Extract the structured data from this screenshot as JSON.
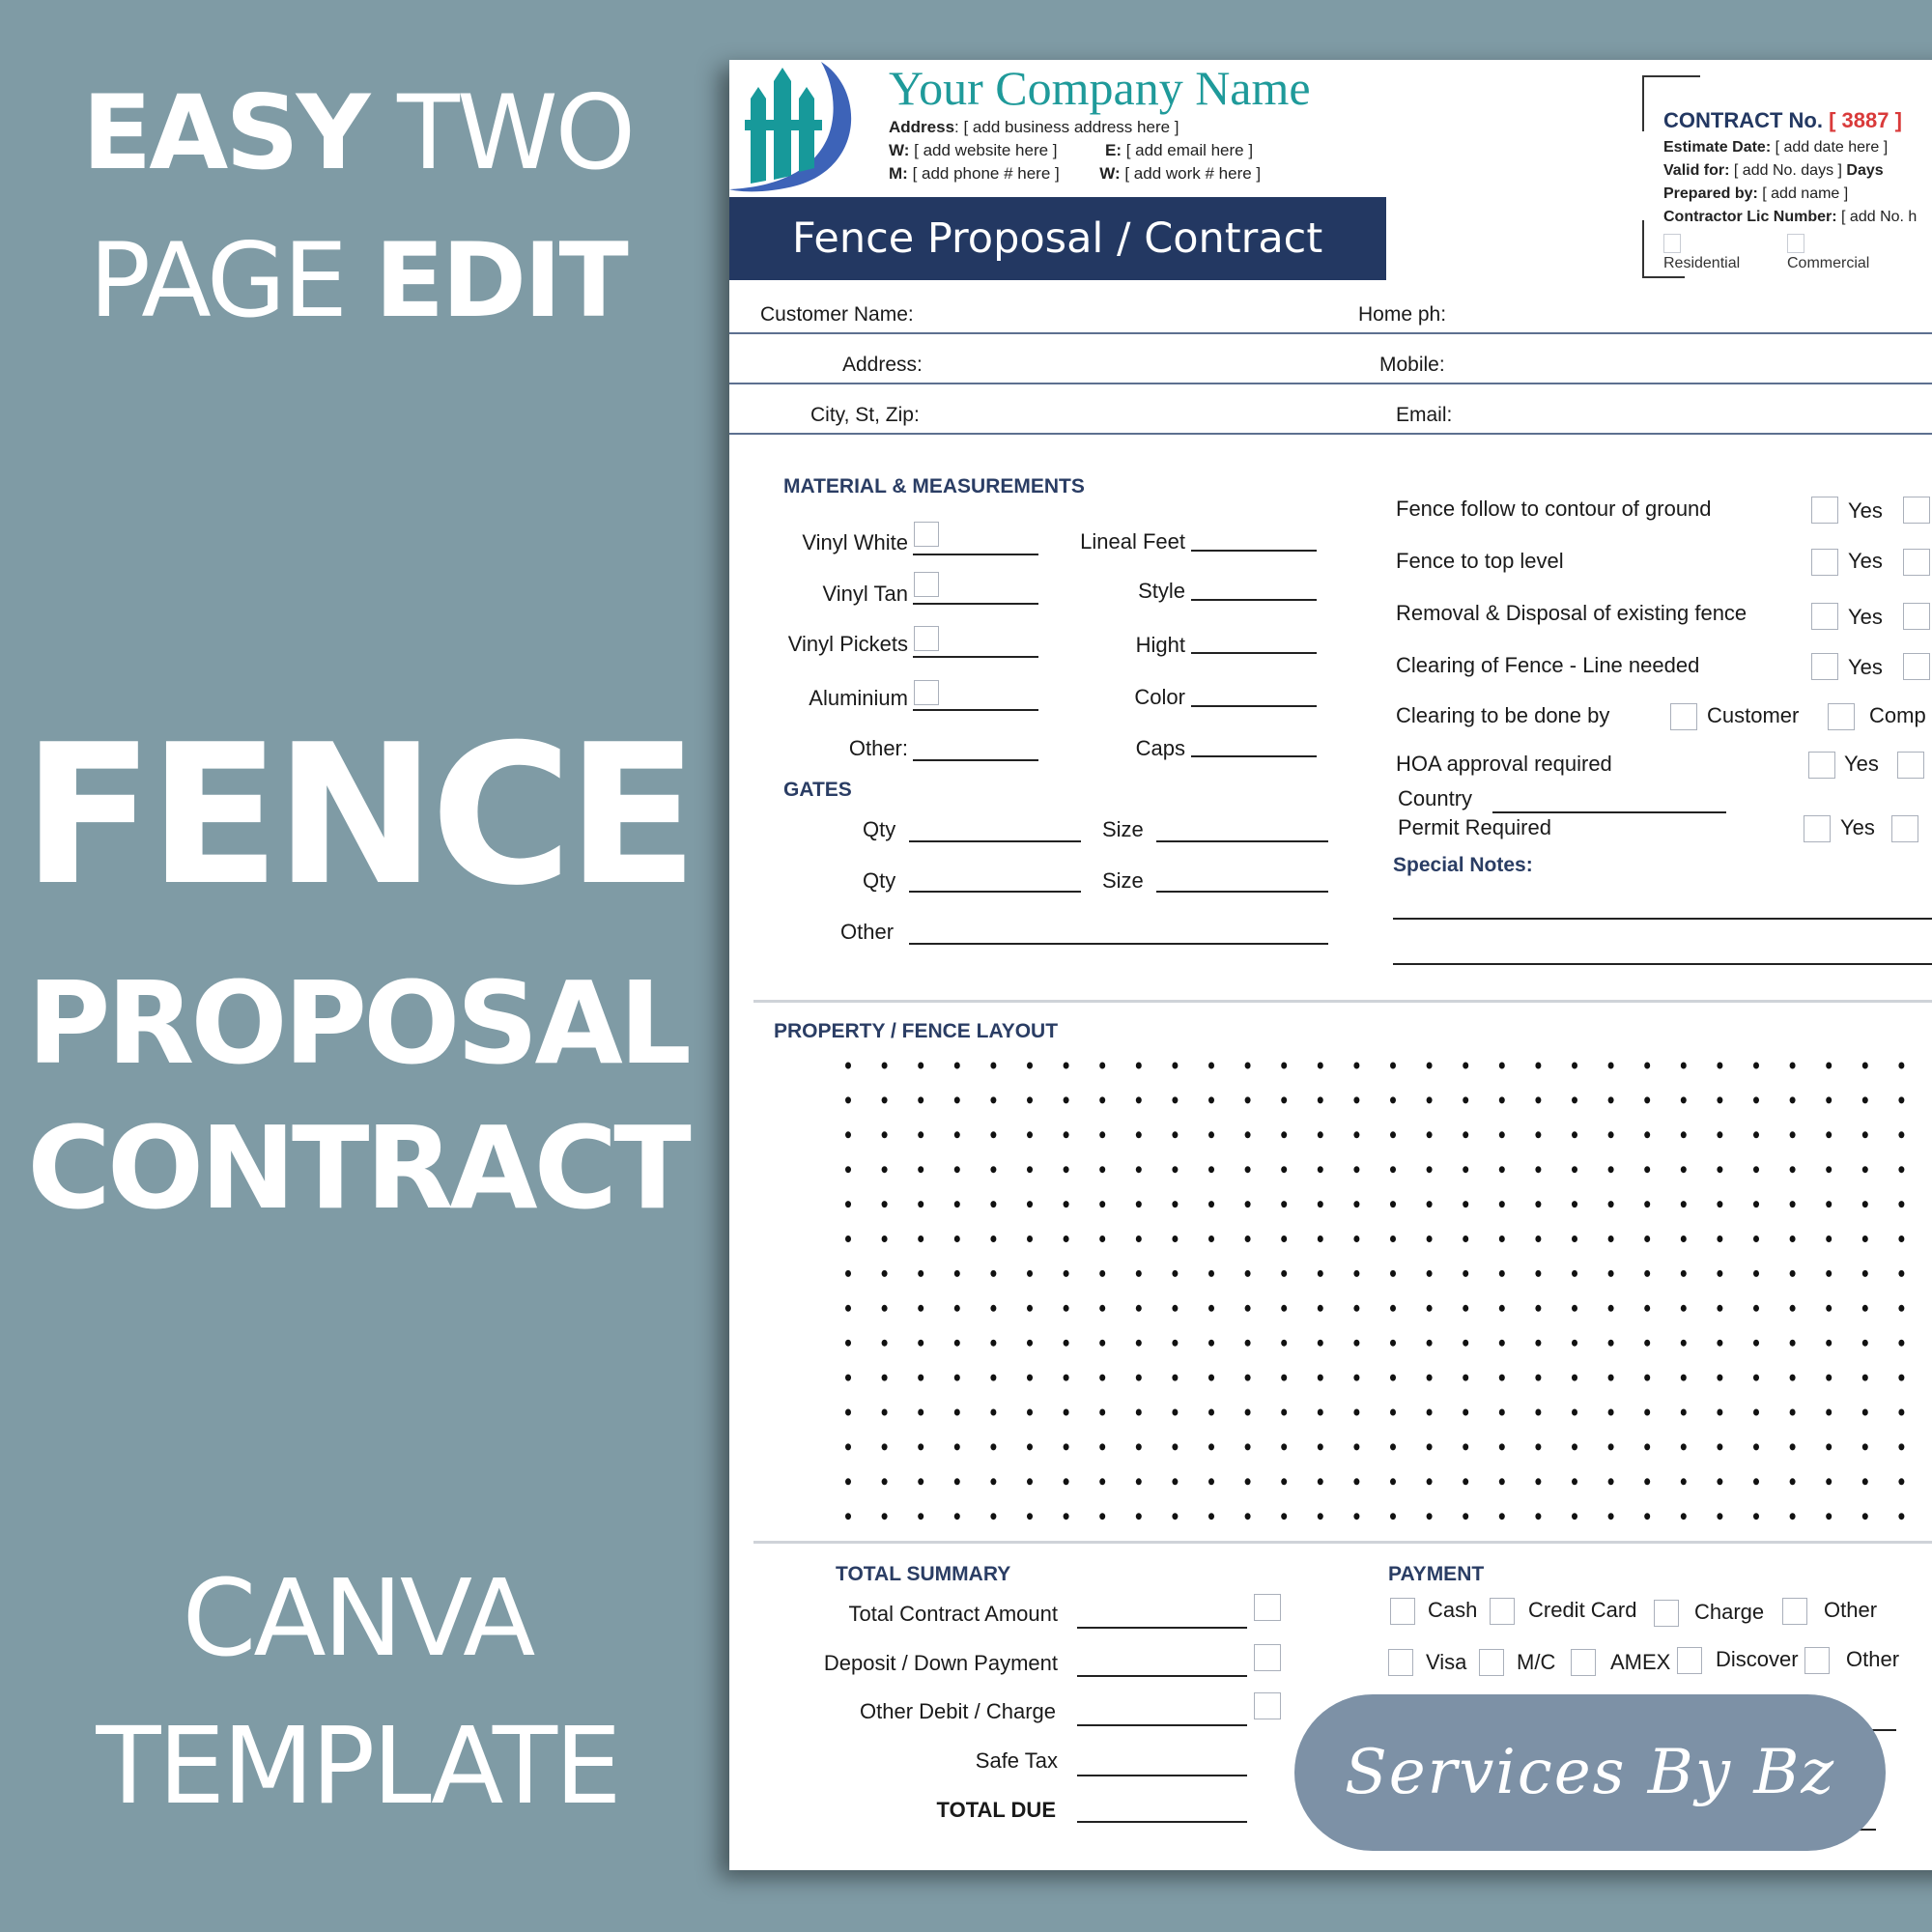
{
  "promo": {
    "line1_bold": "EASY",
    "line1_light": "TWO",
    "line2_light": "PAGE",
    "line2_bold": "EDIT",
    "big_word": "FENCE",
    "word2": "PROPOSAL",
    "word3": "CONTRACT",
    "footer1": "CANVA",
    "footer2": "TEMPLATE"
  },
  "header": {
    "logo_icon": "fence-logo-icon",
    "company_name": "Your Company Name",
    "address_label": "Address",
    "address_value": ": [ add business address here ]",
    "website_label": "W:",
    "website_value": "[ add website here ]",
    "email_label": "E:",
    "email_value": "[ add email here ]",
    "phone_label": "M:",
    "phone_value": "[ add phone # here ]",
    "work_label": "W:",
    "work_value": "[ add work # here ]",
    "title": "Fence Proposal / Contract"
  },
  "contract": {
    "label": "CONTRACT No.",
    "number": "[ 3887 ]",
    "estimate_label": "Estimate Date:",
    "estimate_value": "[ add date here ]",
    "valid_label": "Valid for:",
    "valid_value": "[ add No. days ]",
    "valid_suffix": "Days",
    "prepared_label": "Prepared by:",
    "prepared_value": "[ add name ]",
    "license_label": "Contractor Lic Number:",
    "license_value": "[ add No. h",
    "residential": "Residential",
    "commercial": "Commercial"
  },
  "customer": {
    "name_label": "Customer Name:",
    "home_label": "Home ph:",
    "address_label": "Address:",
    "mobile_label": "Mobile:",
    "city_label": "City, St, Zip:",
    "email_label": "Email:"
  },
  "materials": {
    "heading": "MATERIAL & MEASUREMENTS",
    "left": [
      "Vinyl White",
      "Vinyl Tan",
      "Vinyl Pickets",
      "Aluminium",
      "Other:"
    ],
    "right": [
      "Lineal Feet",
      "Style",
      "Hight",
      "Color",
      "Caps"
    ]
  },
  "gates": {
    "heading": "GATES",
    "qty": "Qty",
    "size": "Size",
    "other": "Other"
  },
  "questions": {
    "items": [
      "Fence follow to contour of ground",
      "Fence to top level",
      "Removal & Disposal of existing fence",
      "Clearing of Fence - Line needed",
      "Clearing to be done by",
      "HOA approval required",
      "Country",
      "Permit Required"
    ],
    "yes": "Yes",
    "customer": "Customer",
    "company_partial": "Comp",
    "notes_heading": "Special Notes:"
  },
  "layout": {
    "heading": "PROPERTY / FENCE LAYOUT"
  },
  "summary": {
    "heading": "TOTAL SUMMARY",
    "items": [
      "Total Contract Amount",
      "Deposit / Down Payment",
      "Other Debit / Charge",
      "Safe Tax",
      "TOTAL DUE"
    ]
  },
  "payment": {
    "heading": "PAYMENT",
    "row1": [
      "Cash",
      "Credit Card",
      "Charge",
      "Other"
    ],
    "row2": [
      "Visa",
      "M/C",
      "AMEX",
      "Discover",
      "Other"
    ]
  },
  "watermark": {
    "text": "Services By Bz"
  },
  "colors": {
    "background": "#7f9ba5",
    "navy": "#233862",
    "teal": "#1f9a9a",
    "red": "#d93a3a",
    "stamp": "#7d91a6"
  }
}
